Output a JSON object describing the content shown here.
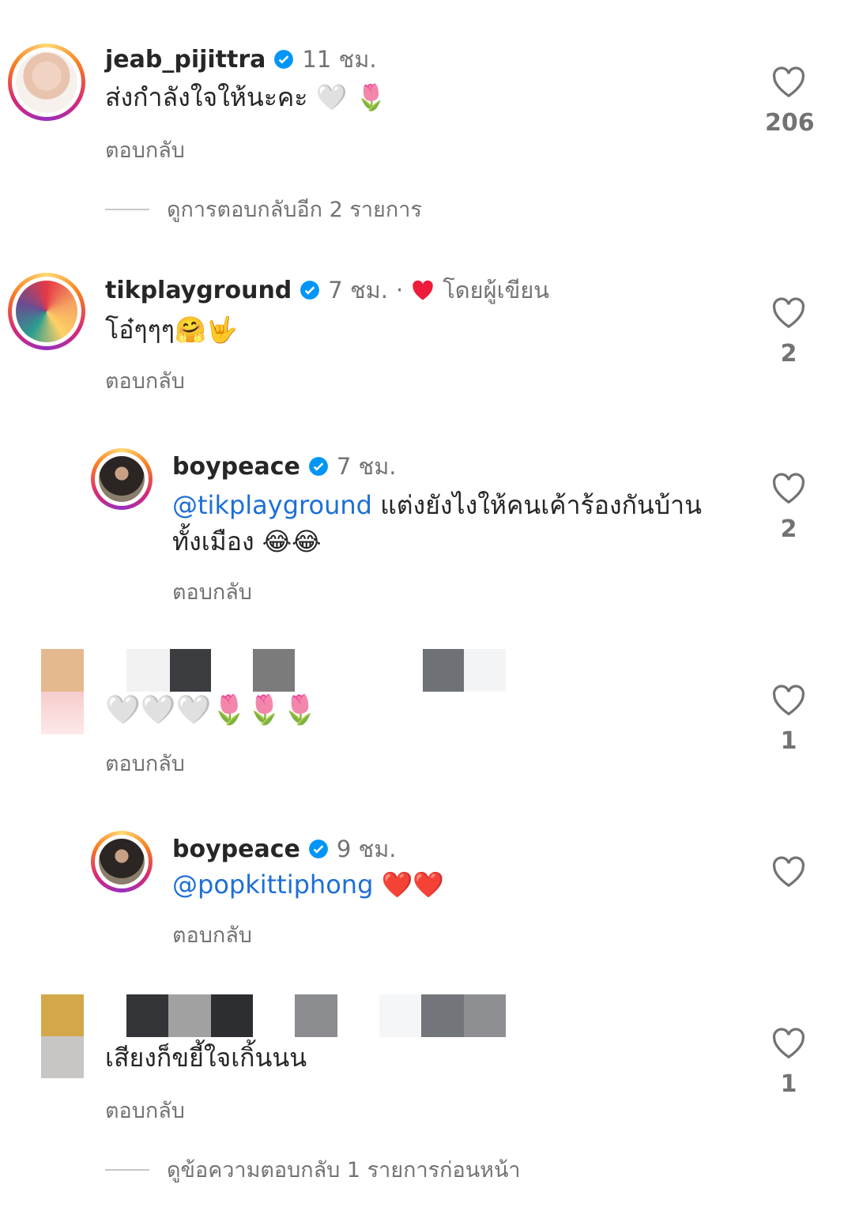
{
  "comments": [
    {
      "username": "jeab_pijittra",
      "time": "11 ชม.",
      "text": "ส่งกำลังใจให้นะคะ",
      "emoji": "🤍 🌷",
      "reply": "ตอบกลับ",
      "likes": "206",
      "view_more": "ดูการตอบกลับอีก 2 รายการ"
    },
    {
      "username": "tikplayground",
      "time": "7 ชม.",
      "dot": "·",
      "author_liked": "โดยผู้เขียน",
      "text": "โอ๋ๆๆๆ",
      "emoji": "🤗🤟",
      "reply": "ตอบกลับ",
      "likes": "2"
    },
    {
      "username": "boypeace",
      "time": "7 ชม.",
      "mention": "@tikplayground",
      "text_line1": " แต่งยังไงให้คนเค้าร้องกันบ้าน",
      "text_line2": "ทั้งเมือง",
      "emoji": "😂😂",
      "reply": "ตอบกลับ",
      "likes": "2"
    },
    {
      "username_hidden": true,
      "emoji": "🤍🤍🤍🌷🌷🌷",
      "reply": "ตอบกลับ",
      "likes": "1"
    },
    {
      "username": "boypeace",
      "time": "9 ชม.",
      "mention": "@popkittiphong",
      "emoji": "❤️❤️",
      "reply": "ตอบกลับ"
    },
    {
      "username_hidden": true,
      "text": "เสียงก็ขยี้ใจเกิ้นนน",
      "reply": "ตอบกลับ",
      "likes": "1",
      "view_more": "ดูข้อความตอบกลับ 1 รายการก่อนหน้า"
    }
  ],
  "icons": {
    "like": "heart-outline-icon",
    "verified": "verified-badge-icon",
    "author_heart": "red-heart-icon"
  },
  "colors": {
    "verified": "#0095f6",
    "mention": "#1d6fd6",
    "secondary": "#737373",
    "heart_red": "#ed1c3b"
  }
}
